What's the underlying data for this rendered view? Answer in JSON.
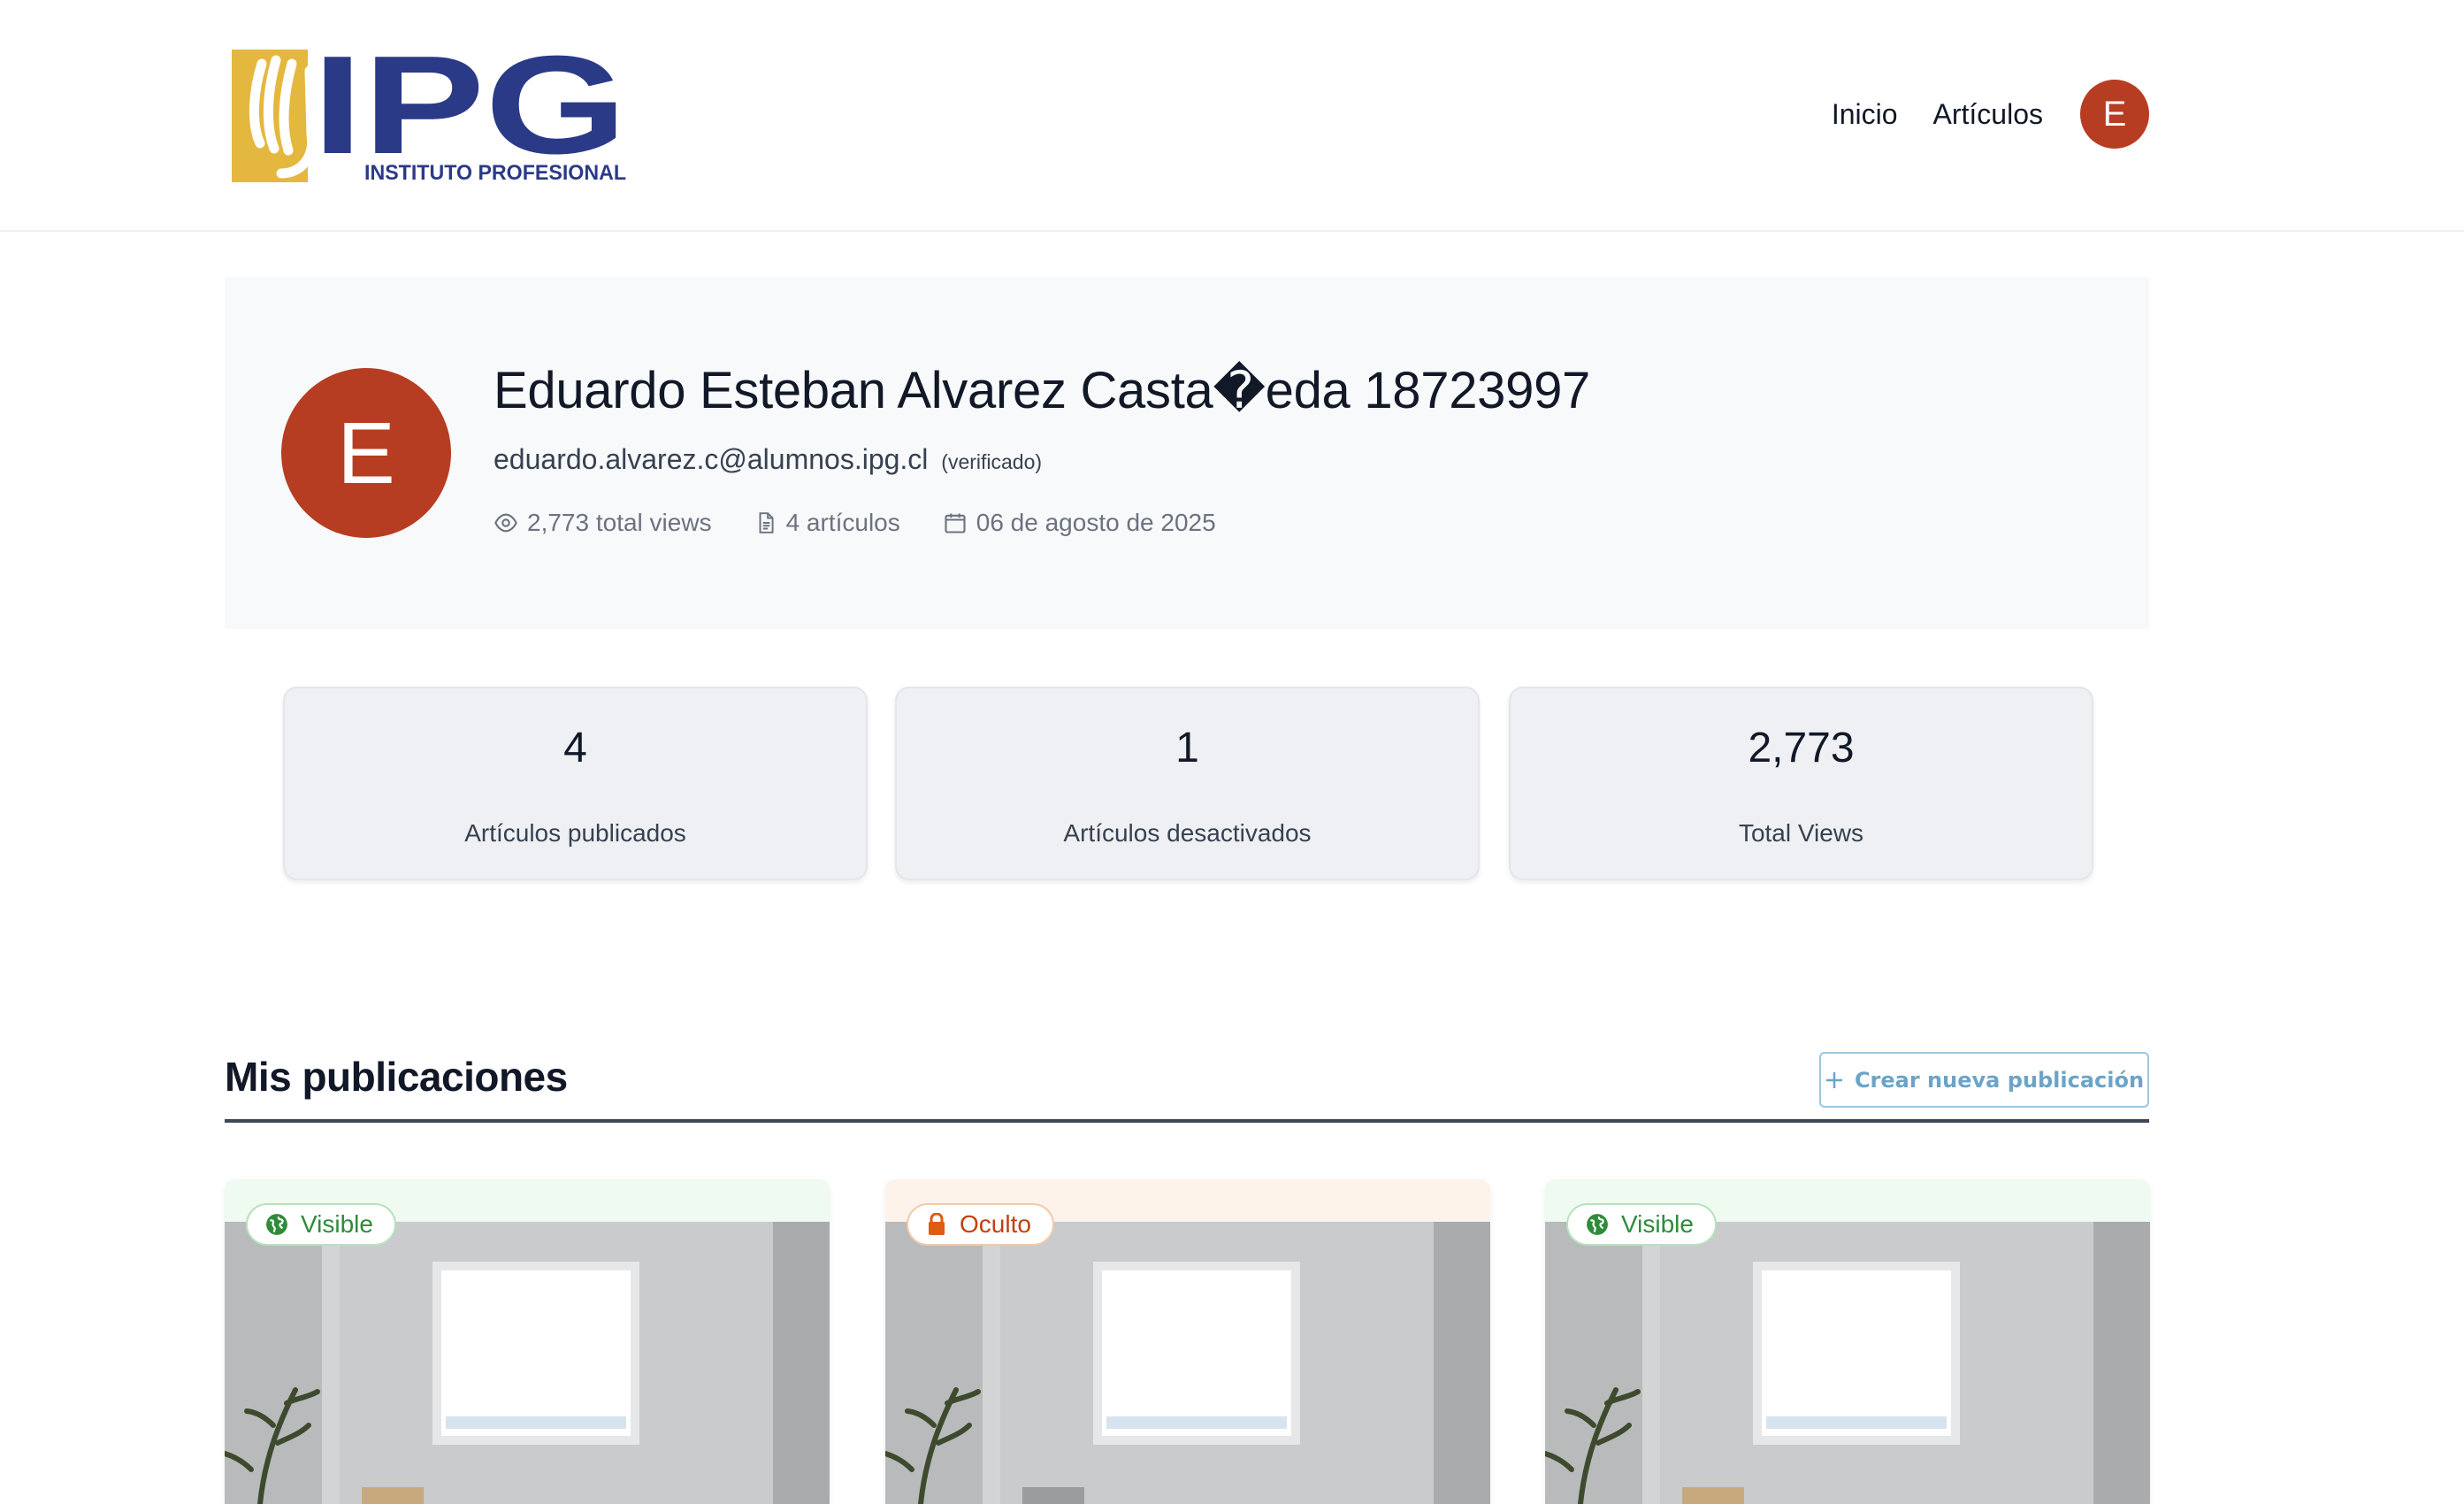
{
  "header": {
    "logo_text": "IPG",
    "logo_subtext": "INSTITUTO PROFESIONAL",
    "nav": [
      {
        "label": "Inicio"
      },
      {
        "label": "Artículos"
      }
    ],
    "avatar_initial": "E"
  },
  "profile": {
    "avatar_initial": "E",
    "name": "Eduardo Esteban Alvarez Casta�eda 18723997",
    "email": "eduardo.alvarez.c@alumnos.ipg.cl",
    "verified_label": "(verificado)",
    "views": "2,773 total views",
    "articles": "4 artículos",
    "date": "06 de agosto de 2025"
  },
  "stats": [
    {
      "value": "4",
      "label": "Artículos publicados"
    },
    {
      "value": "1",
      "label": "Artículos desactivados"
    },
    {
      "value": "2,773",
      "label": "Total Views"
    }
  ],
  "publications": {
    "title": "Mis publicaciones",
    "create_button": "Crear nueva publicación",
    "cards": [
      {
        "status": "Visible",
        "status_icon": "globe-icon"
      },
      {
        "status": "Oculto",
        "status_icon": "lock-icon"
      },
      {
        "status": "Visible",
        "status_icon": "globe-icon"
      }
    ]
  },
  "colors": {
    "avatar": "#b73d22",
    "visible": "#2f8b3b",
    "hidden": "#c2410c",
    "logo_blue": "#2b3a87",
    "logo_gold": "#e4b83f"
  }
}
